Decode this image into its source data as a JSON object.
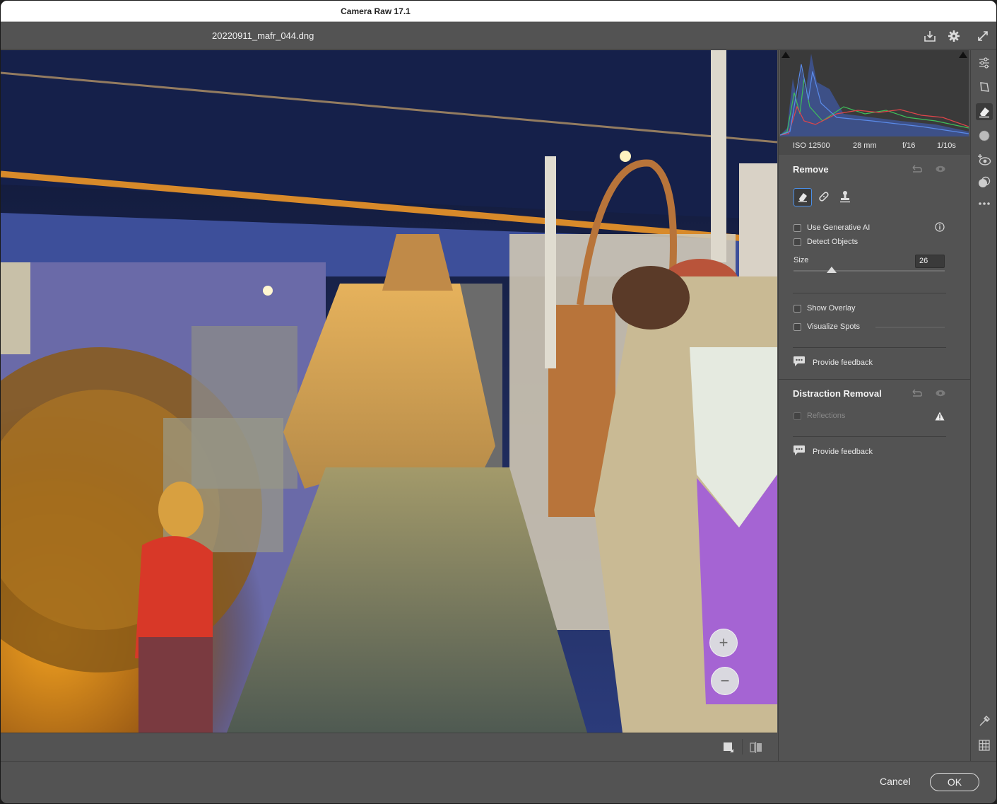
{
  "window": {
    "title": "Camera Raw 17.1"
  },
  "header": {
    "filename": "20220911_mafr_044.dng"
  },
  "exif": {
    "iso": "ISO 12500",
    "focal": "28 mm",
    "aperture": "f/16",
    "shutter": "1/10s"
  },
  "remove": {
    "title": "Remove",
    "use_gen_ai": "Use Generative AI",
    "detect_objects": "Detect Objects",
    "size_label": "Size",
    "size_value": 26,
    "show_overlay": "Show Overlay",
    "visualize_spots": "Visualize Spots",
    "feedback": "Provide feedback"
  },
  "distraction": {
    "title": "Distraction Removal",
    "reflections": "Reflections",
    "feedback": "Provide feedback"
  },
  "canvas": {
    "zoom_in": "+",
    "zoom_out": "−"
  },
  "footer": {
    "cancel": "Cancel",
    "ok": "OK"
  },
  "icons": {
    "header": [
      "save-icon",
      "gear-icon",
      "fullscreen-icon"
    ],
    "toolbar": [
      "edit-sliders-icon",
      "crop-icon",
      "remove-eraser-icon",
      "masking-icon",
      "red-eye-icon",
      "presets-icon",
      "more-icon",
      "sampler-icon",
      "grid-icon"
    ]
  },
  "colors": {
    "accent": "#4a8fe8",
    "panel": "#535353",
    "overlay_purple": "#a35fd6"
  }
}
